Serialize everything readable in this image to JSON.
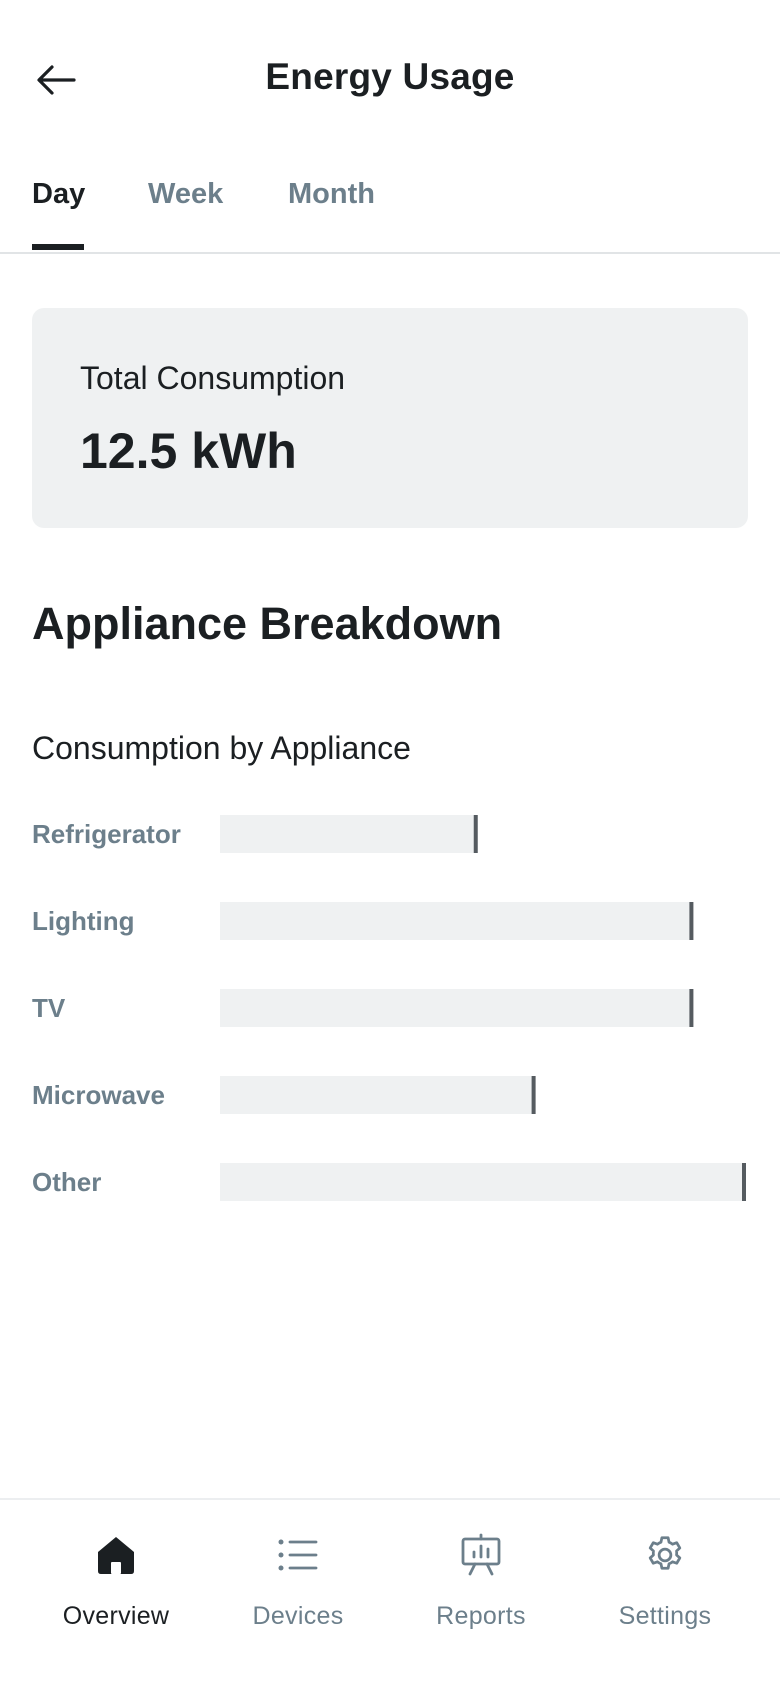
{
  "header": {
    "title": "Energy Usage"
  },
  "tabs": [
    {
      "label": "Day",
      "active": true
    },
    {
      "label": "Week",
      "active": false
    },
    {
      "label": "Month",
      "active": false
    }
  ],
  "summary": {
    "label": "Total Consumption",
    "value": "12.5 kWh"
  },
  "section": {
    "title": "Appliance Breakdown"
  },
  "chart_title": "Consumption by Appliance",
  "chart_data": {
    "type": "bar",
    "orientation": "horizontal",
    "title": "Consumption by Appliance",
    "categories": [
      "Refrigerator",
      "Lighting",
      "TV",
      "Microwave",
      "Other"
    ],
    "values": [
      0.49,
      0.9,
      0.9,
      0.6,
      1.0
    ],
    "value_units": "fraction of the largest bar (no axis or values printed)",
    "xlabel": "",
    "ylabel": "",
    "grid": false,
    "legend": "none"
  },
  "bottom_nav": [
    {
      "label": "Overview",
      "icon": "home-icon",
      "active": true
    },
    {
      "label": "Devices",
      "icon": "list-icon",
      "active": false
    },
    {
      "label": "Reports",
      "icon": "presentation-chart-icon",
      "active": false
    },
    {
      "label": "Settings",
      "icon": "gear-icon",
      "active": false
    }
  ],
  "colors": {
    "text_primary": "#1b1f22",
    "text_muted": "#6c7f8b",
    "bar_fill": "#eff1f2",
    "bar_marker": "#555b60"
  }
}
